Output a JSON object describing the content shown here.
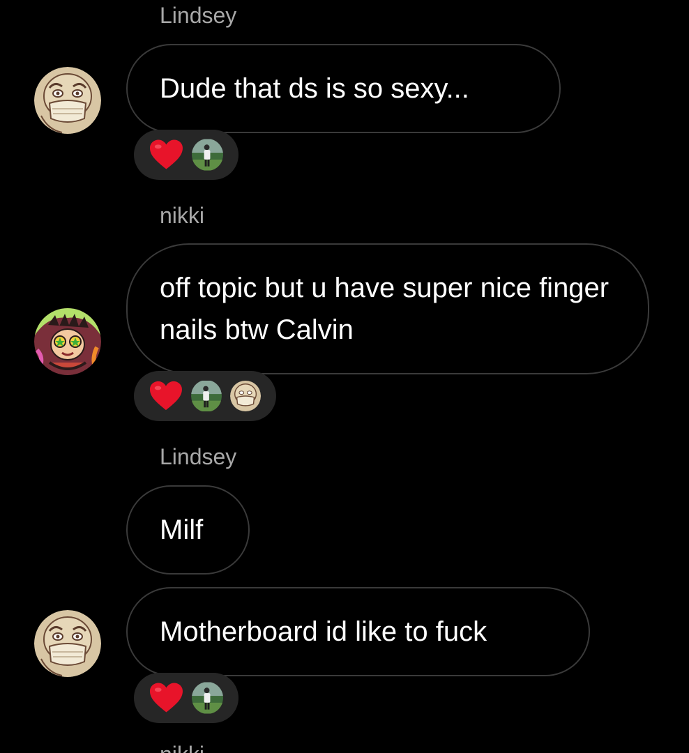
{
  "messages": [
    {
      "sender": "Lindsey",
      "text": "Dude that ds is so sexy...",
      "reactions": [
        "heart",
        "golfer-avatar"
      ]
    },
    {
      "sender": "nikki",
      "text": "off topic but u have super nice finger nails btw Calvin",
      "reactions": [
        "heart",
        "golfer-avatar",
        "masked-face-avatar"
      ]
    },
    {
      "sender": "Lindsey",
      "text": "Milf",
      "reactions": []
    },
    {
      "sender": "",
      "text": "Motherboard id like to fuck",
      "reactions": [
        "heart",
        "golfer-avatar"
      ]
    }
  ],
  "next_sender_partial": "nikki",
  "colors": {
    "background": "#000000",
    "bubble_border": "#3a3a3a",
    "reaction_pill": "#262626",
    "sender_name": "#a8a8a8",
    "heart": "#e8142a"
  },
  "icons": [
    "heart-emoji-icon",
    "masked-face-avatar",
    "anime-avatar",
    "golfer-avatar"
  ]
}
